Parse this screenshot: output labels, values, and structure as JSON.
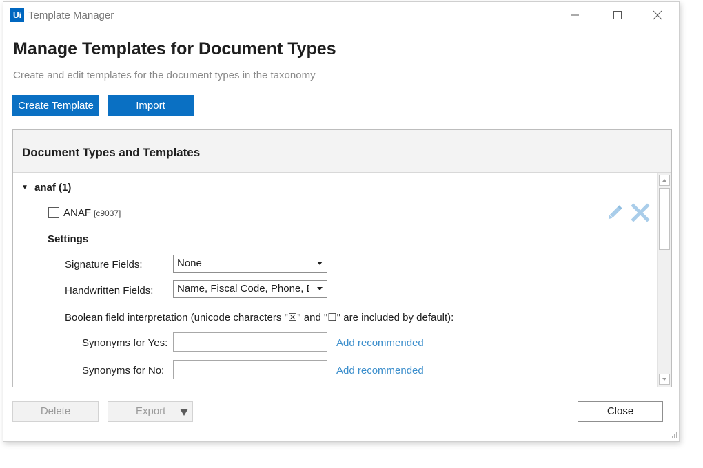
{
  "window": {
    "app_icon_text": "Ui",
    "title": "Template Manager"
  },
  "header": {
    "title": "Manage Templates for Document Types",
    "subtitle": "Create and edit templates for the document types in the taxonomy"
  },
  "toolbar": {
    "create_label": "Create Template",
    "import_label": "Import"
  },
  "panel": {
    "title": "Document Types and Templates",
    "group": {
      "label": "anaf (1)",
      "expanded": true,
      "template": {
        "name": "ANAF",
        "id": "[c9037]",
        "checked": false
      }
    },
    "settings": {
      "label": "Settings",
      "signature_label": "Signature Fields:",
      "signature_value": "None",
      "handwritten_label": "Handwritten Fields:",
      "handwritten_value": "Name, Fiscal Code, Phone, E-mail",
      "boolean_label": "Boolean field interpretation (unicode characters \"☒\" and \"☐\" are included by default):",
      "yes_label": "Synonyms for Yes:",
      "yes_value": "",
      "no_label": "Synonyms for No:",
      "no_value": "",
      "add_recommended_yes": "Add recommended",
      "add_recommended_no": "Add recommended"
    }
  },
  "footer": {
    "delete_label": "Delete",
    "export_label": "Export",
    "close_label": "Close"
  },
  "colors": {
    "primary": "#0a70c3",
    "link": "#3d8fcc",
    "icon_light": "#a9cdea"
  }
}
